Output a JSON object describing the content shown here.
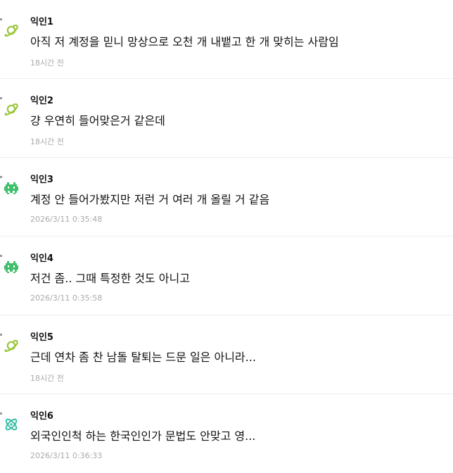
{
  "comments": [
    {
      "nickname": "익인1",
      "text": "아직 저 계정을 믿니 망상으로 오천 개 내뱉고 한 개 맞히는 사람임",
      "time": "18시간 전",
      "avatar_icon": "planet-icon",
      "avatar_color": "#9bc53d"
    },
    {
      "nickname": "익인2",
      "text": "걍 우연히 들어맞은거 같은데",
      "time": "18시간 전",
      "avatar_icon": "planet-icon",
      "avatar_color": "#9bc53d"
    },
    {
      "nickname": "익인3",
      "text": "계정 안 들어가봤지만 저런 거 여러 개 올릴 거 같음",
      "time": "2026/3/11 0:35:48",
      "avatar_icon": "space-invader-icon",
      "avatar_color": "#3fbf6a"
    },
    {
      "nickname": "익인4",
      "text": "저건 좀.. 그때 특정한 것도 아니고",
      "time": "2026/3/11 0:35:58",
      "avatar_icon": "space-invader-icon",
      "avatar_color": "#3fbf6a"
    },
    {
      "nickname": "익인5",
      "text": "근데 연차 좀 찬 남돌 탈퇴는 드문 일은 아니라...",
      "time": "18시간 전",
      "avatar_icon": "planet-icon",
      "avatar_color": "#9bc53d"
    },
    {
      "nickname": "익인6",
      "text": "외국인인척 하는 한국인인가 문법도 안맞고 영...",
      "time": "2026/3/11 0:36:33",
      "avatar_icon": "atom-icon",
      "avatar_color": "#2bbba0"
    }
  ]
}
